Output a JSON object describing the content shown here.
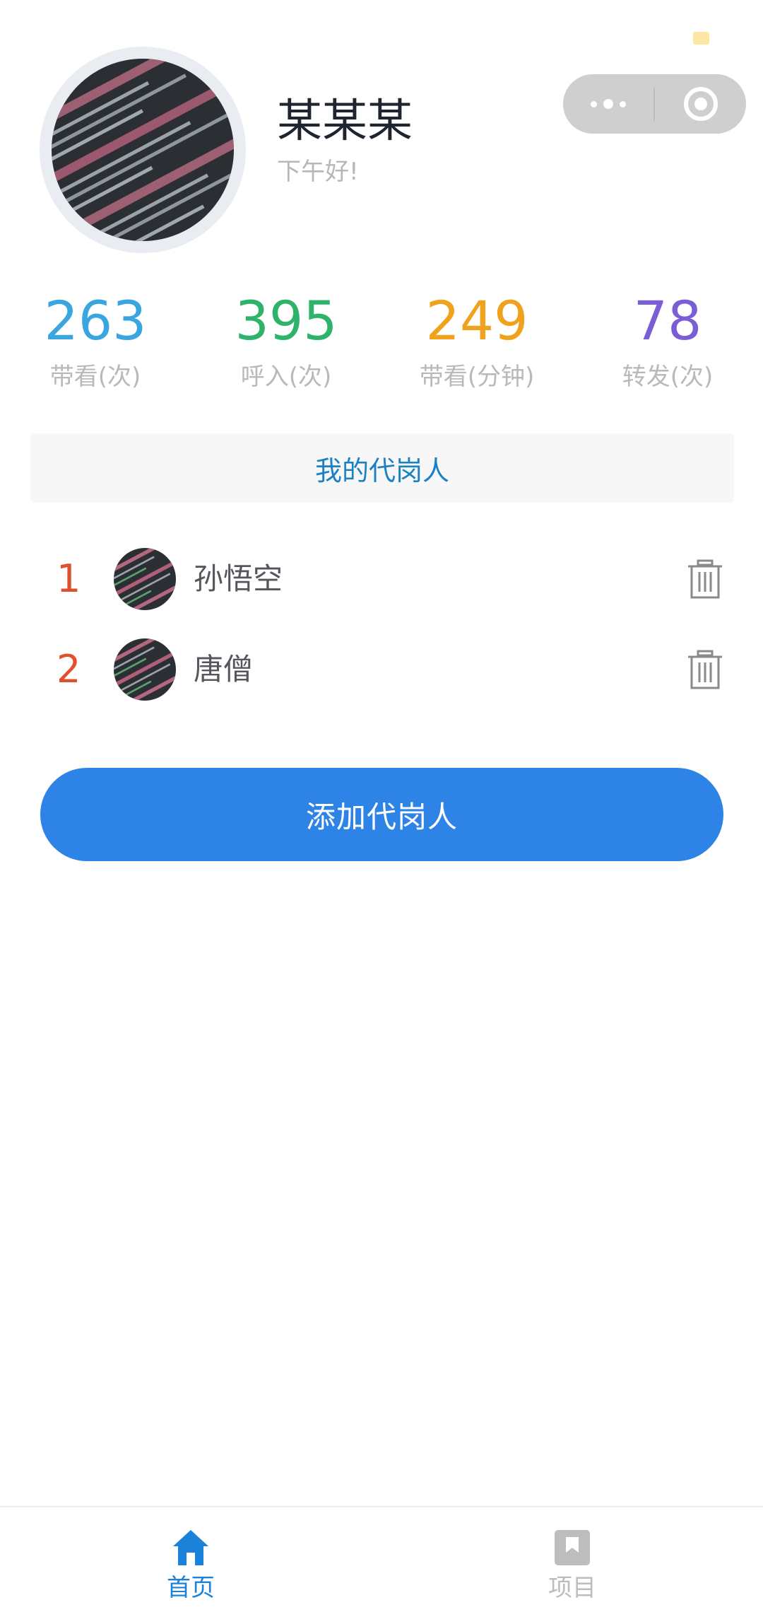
{
  "user": {
    "name": "某某某",
    "greeting": "下午好!"
  },
  "stats": [
    {
      "value": "263",
      "label": "带看(次)",
      "color": "#3aa6e0"
    },
    {
      "value": "395",
      "label": "呼入(次)",
      "color": "#2fb36a"
    },
    {
      "value": "249",
      "label": "带看(分钟)",
      "color": "#f0a21c"
    },
    {
      "value": "78",
      "label": "转发(次)",
      "color": "#7a5ed6"
    }
  ],
  "section_title": "我的代岗人",
  "agents": [
    {
      "index": "1",
      "name": "孙悟空"
    },
    {
      "index": "2",
      "name": "唐僧"
    }
  ],
  "add_button_label": "添加代岗人",
  "tabbar": {
    "items": [
      {
        "label": "首页",
        "icon": "home-icon",
        "active": true
      },
      {
        "label": "项目",
        "icon": "bookmark-icon",
        "active": false
      }
    ],
    "active_color": "#1a82d8",
    "inactive_color": "#bdbdbd"
  },
  "colors": {
    "accent": "#2e84e6",
    "index_color": "#e0502c"
  }
}
